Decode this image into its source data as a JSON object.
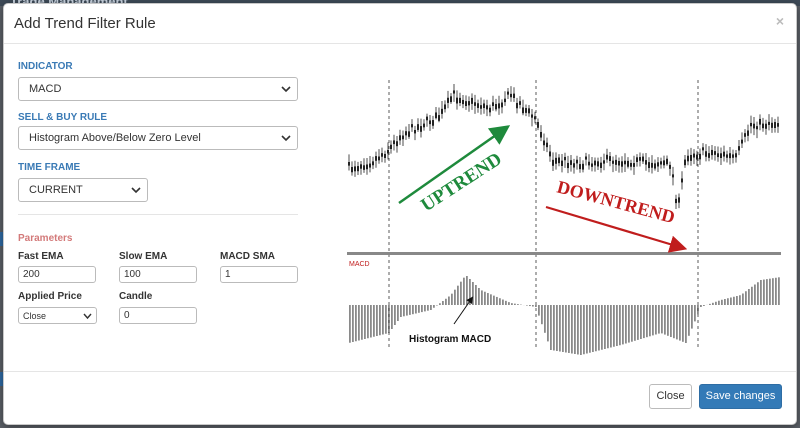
{
  "background": {
    "title_fragment": "Trade Management"
  },
  "modal": {
    "title": "Add Trend Filter Rule",
    "close_glyph": "×",
    "indicator": {
      "label": "INDICATOR",
      "value": "MACD"
    },
    "rule": {
      "label": "SELL & BUY RULE",
      "value": "Histogram Above/Below Zero Level"
    },
    "time_frame": {
      "label": "TIME FRAME",
      "value": "CURRENT"
    },
    "parameters": {
      "label": "Parameters",
      "fast_ema": {
        "label": "Fast EMA",
        "value": "200"
      },
      "slow_ema": {
        "label": "Slow EMA",
        "value": "100"
      },
      "macd_sma": {
        "label": "MACD SMA",
        "value": "1"
      },
      "applied_price": {
        "label": "Applied Price",
        "value": "Close"
      },
      "candle": {
        "label": "Candle",
        "value": "0"
      }
    },
    "illustration": {
      "uptrend_label": "UPTREND",
      "downtrend_label": "DOWNTREND",
      "indicator_tag": "MACD",
      "histogram_label": "Histogram MACD",
      "colors": {
        "uptrend": "#1e8a3c",
        "downtrend": "#c01d1d",
        "bars": "#8a8a8a",
        "candles": "#222222"
      }
    },
    "footer": {
      "close_label": "Close",
      "save_label": "Save changes"
    },
    "colors": {
      "section_label": "#3a7ab5",
      "params_label": "#d37a7a",
      "primary": "#337ab7"
    }
  }
}
